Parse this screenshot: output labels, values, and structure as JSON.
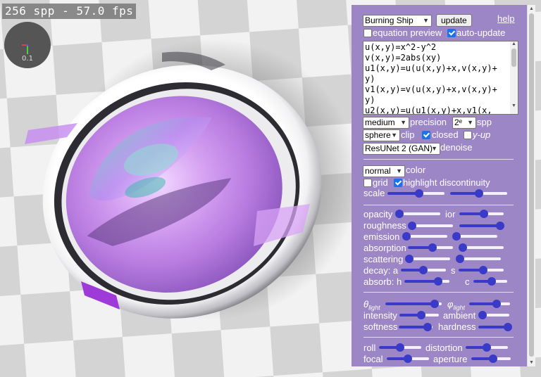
{
  "stats": {
    "fps_text": "256 spp - 57.0 fps",
    "axis_scale": "0.1"
  },
  "header": {
    "preset": "Burning Ship",
    "update_label": "update",
    "help_label": "help"
  },
  "options": {
    "equation_preview": {
      "label": "equation preview",
      "checked": false
    },
    "auto_update": {
      "label": "auto-update",
      "checked": true
    }
  },
  "equations": {
    "text": "u(x,y)=x^2-y^2\nv(x,y)=2abs(xy)\nu1(x,y)=u(u(x,y)+x,v(x,y)+y)\nv1(x,y)=v(u(x,y)+x,v(x,y)+y)\nu2(x,y)=u(u1(x,y)+x,v1(x,"
  },
  "render": {
    "precision_value": "medium",
    "precision_label": "precision",
    "spp_value": "2ᵉ",
    "spp_label": "spp",
    "clip_value": "sphere",
    "clip_label": "clip",
    "closed": {
      "label": "closed",
      "checked": true
    },
    "yup": {
      "label": "y-up",
      "checked": false
    },
    "denoise_value": "ResUNet 2 (GAN)",
    "denoise_label": "denoise"
  },
  "color": {
    "mode_value": "normal",
    "mode_label": "color",
    "grid": {
      "label": "grid",
      "checked": false
    },
    "highlight": {
      "label": "highlight discontinuity",
      "checked": true
    },
    "scale_label": "scale"
  },
  "material": {
    "opacity": "opacity",
    "ior": "ior",
    "roughness": "roughness",
    "emission": "emission",
    "absorption": "absorption",
    "scattering": "scattering",
    "decay": "decay: a",
    "s": "s",
    "absorb": "absorb: h",
    "c": "c"
  },
  "lighting": {
    "theta_sym": "θ",
    "phi_sym": "φ",
    "sub": "light",
    "intensity": "intensity",
    "ambient": "ambient",
    "softness": "softness",
    "hardness": "hardness"
  },
  "camera": {
    "roll": "roll",
    "distortion": "distortion",
    "focal": "focal",
    "aperture": "aperture"
  },
  "sliders": {
    "scale_a": 0.55,
    "scale_b": 0.5,
    "opacity": 0.0,
    "ior": 0.55,
    "roughness": 0.0,
    "roughness_b": 1.0,
    "emission": 0.0,
    "emission_b": 0.0,
    "absorption": 0.55,
    "absorption_b": 0.0,
    "scattering": 0.0,
    "scattering_b": 0.0,
    "decay_a": 0.5,
    "decay_s": 0.55,
    "absorb_h": 0.75,
    "absorb_c": 0.55,
    "theta": 0.88,
    "phi": 0.68,
    "intensity": 0.55,
    "ambient": 0.0,
    "softness": 0.85,
    "hardness": 1.0,
    "roll": 0.5,
    "distortion": 0.5,
    "focal": 0.5,
    "aperture": 0.55
  },
  "theme": {
    "panel_bg": "#9c86c6",
    "slider_color": "#3a3ac8",
    "checkbox_color": "#1a73e8"
  }
}
